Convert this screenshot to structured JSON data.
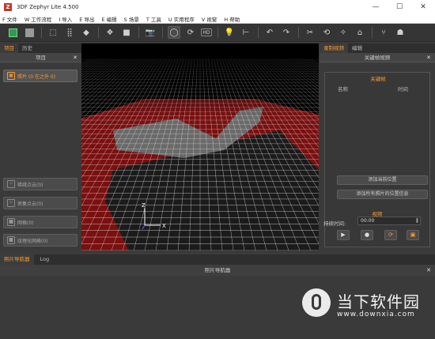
{
  "window": {
    "logo": "Z",
    "title": "3DF Zephyr Lite 4.500",
    "controls": [
      "minimize-icon",
      "maximize-icon",
      "close-icon"
    ],
    "control_glyphs": [
      "—",
      "☐",
      "✕"
    ]
  },
  "menu": [
    "F 文件",
    "W 工作流程",
    "I 导入",
    "E 导出",
    "E 编辑",
    "S 场景",
    "T 工具",
    "U 实用程序",
    "V 视窗",
    "H 帮助"
  ],
  "toolbar": {
    "icons": [
      "green-cube-icon",
      "gray-cube-icon",
      "select-box-icon",
      "point-cloud-icon",
      "cube-icon",
      "cubes-icon",
      "solid-cube-icon",
      "camera-icon",
      "orbit-icon",
      "rotate-icon",
      "hd-icon",
      "light-bulb-icon",
      "ruler-icon",
      "undo-icon",
      "redo-icon",
      "lasso-icon",
      "refresh-icon",
      "compass-icon",
      "measure-icon",
      "brush-icon",
      "mask-icon"
    ],
    "glyphs": [
      "",
      "",
      "⬚",
      "⣿",
      "◆",
      "❖",
      "■",
      "📷",
      "◯",
      "⟳",
      "HD",
      "💡",
      "⊢",
      "↶",
      "↷",
      "✂",
      "⟲",
      "✧",
      "⌂",
      "⑂",
      "☗"
    ],
    "active_index": 8
  },
  "left_panel": {
    "tabs": [
      "项目",
      "历史"
    ],
    "active_tab": 0,
    "header": "项目",
    "photos_button": "照片 (0 在之外 0)",
    "workflow_buttons": [
      {
        "label": "稀疏点云(0)",
        "icon": "sparse-cloud-icon",
        "glyph": "⁘"
      },
      {
        "label": "密集点云(0)",
        "icon": "dense-cloud-icon",
        "glyph": "⁙"
      },
      {
        "label": "网格(0)",
        "icon": "mesh-icon",
        "glyph": "▦"
      },
      {
        "label": "纹理化网格(0)",
        "icon": "textured-mesh-icon",
        "glyph": "▩"
      }
    ]
  },
  "viewport": {
    "axis_x": "X",
    "axis_z": "Z"
  },
  "right_panel": {
    "tabs": [
      "录制视频",
      "编辑"
    ],
    "active_tab": 0,
    "header": "关键帧视频",
    "keyframes_title": "关键帧",
    "columns": [
      "名称",
      "时间"
    ],
    "add_current": "添加当前位置",
    "add_all": "添加所有照片的位置信息",
    "video_title": "视频",
    "duration_label": "持续时间:",
    "duration_value": "00:00",
    "playback_glyphs": [
      "▶",
      "●",
      "⟳",
      "▣"
    ]
  },
  "bottom_panel": {
    "tabs": [
      "照片导航器",
      "Log"
    ],
    "active_tab": 0,
    "header": "照片导航器"
  },
  "watermark": {
    "brand": "当下软件园",
    "url": "www.downxia.com"
  }
}
